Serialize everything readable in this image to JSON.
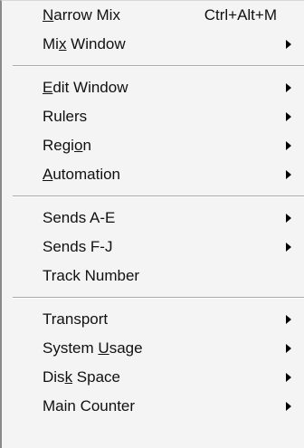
{
  "menu": {
    "items": [
      {
        "id": "narrow-mix",
        "label_pre": "",
        "mnemonic": "N",
        "label_post": "arrow Mix",
        "shortcut": "Ctrl+Alt+M",
        "submenu": false
      },
      {
        "id": "mix-window",
        "label_pre": "Mi",
        "mnemonic": "x",
        "label_post": " Window",
        "shortcut": "",
        "submenu": true
      },
      {
        "id": "edit-window",
        "label_pre": "",
        "mnemonic": "E",
        "label_post": "dit Window",
        "shortcut": "",
        "submenu": true
      },
      {
        "id": "rulers",
        "label_pre": "Rulers",
        "mnemonic": "",
        "label_post": "",
        "shortcut": "",
        "submenu": true
      },
      {
        "id": "region",
        "label_pre": "Regi",
        "mnemonic": "o",
        "label_post": "n",
        "shortcut": "",
        "submenu": true
      },
      {
        "id": "automation",
        "label_pre": "",
        "mnemonic": "A",
        "label_post": "utomation",
        "shortcut": "",
        "submenu": true
      },
      {
        "id": "sends-a-e",
        "label_pre": "Sends A-E",
        "mnemonic": "",
        "label_post": "",
        "shortcut": "",
        "submenu": true
      },
      {
        "id": "sends-f-j",
        "label_pre": "Sends F-J",
        "mnemonic": "",
        "label_post": "",
        "shortcut": "",
        "submenu": true
      },
      {
        "id": "track-number",
        "label_pre": "Track Number",
        "mnemonic": "",
        "label_post": "",
        "shortcut": "",
        "submenu": false
      },
      {
        "id": "transport",
        "label_pre": "Transport",
        "mnemonic": "",
        "label_post": "",
        "shortcut": "",
        "submenu": true
      },
      {
        "id": "system-usage",
        "label_pre": "System ",
        "mnemonic": "U",
        "label_post": "sage",
        "shortcut": "",
        "submenu": true
      },
      {
        "id": "disk-space",
        "label_pre": "Dis",
        "mnemonic": "k",
        "label_post": " Space",
        "shortcut": "",
        "submenu": true
      },
      {
        "id": "main-counter",
        "label_pre": "Main Counter",
        "mnemonic": "",
        "label_post": "",
        "shortcut": "",
        "submenu": true
      }
    ]
  },
  "icons": {
    "submenu_arrow": "submenu-arrow-icon"
  },
  "colors": {
    "menu_background": "#f4f4f4",
    "separator": "#a9a9a9",
    "text": "#111111"
  }
}
